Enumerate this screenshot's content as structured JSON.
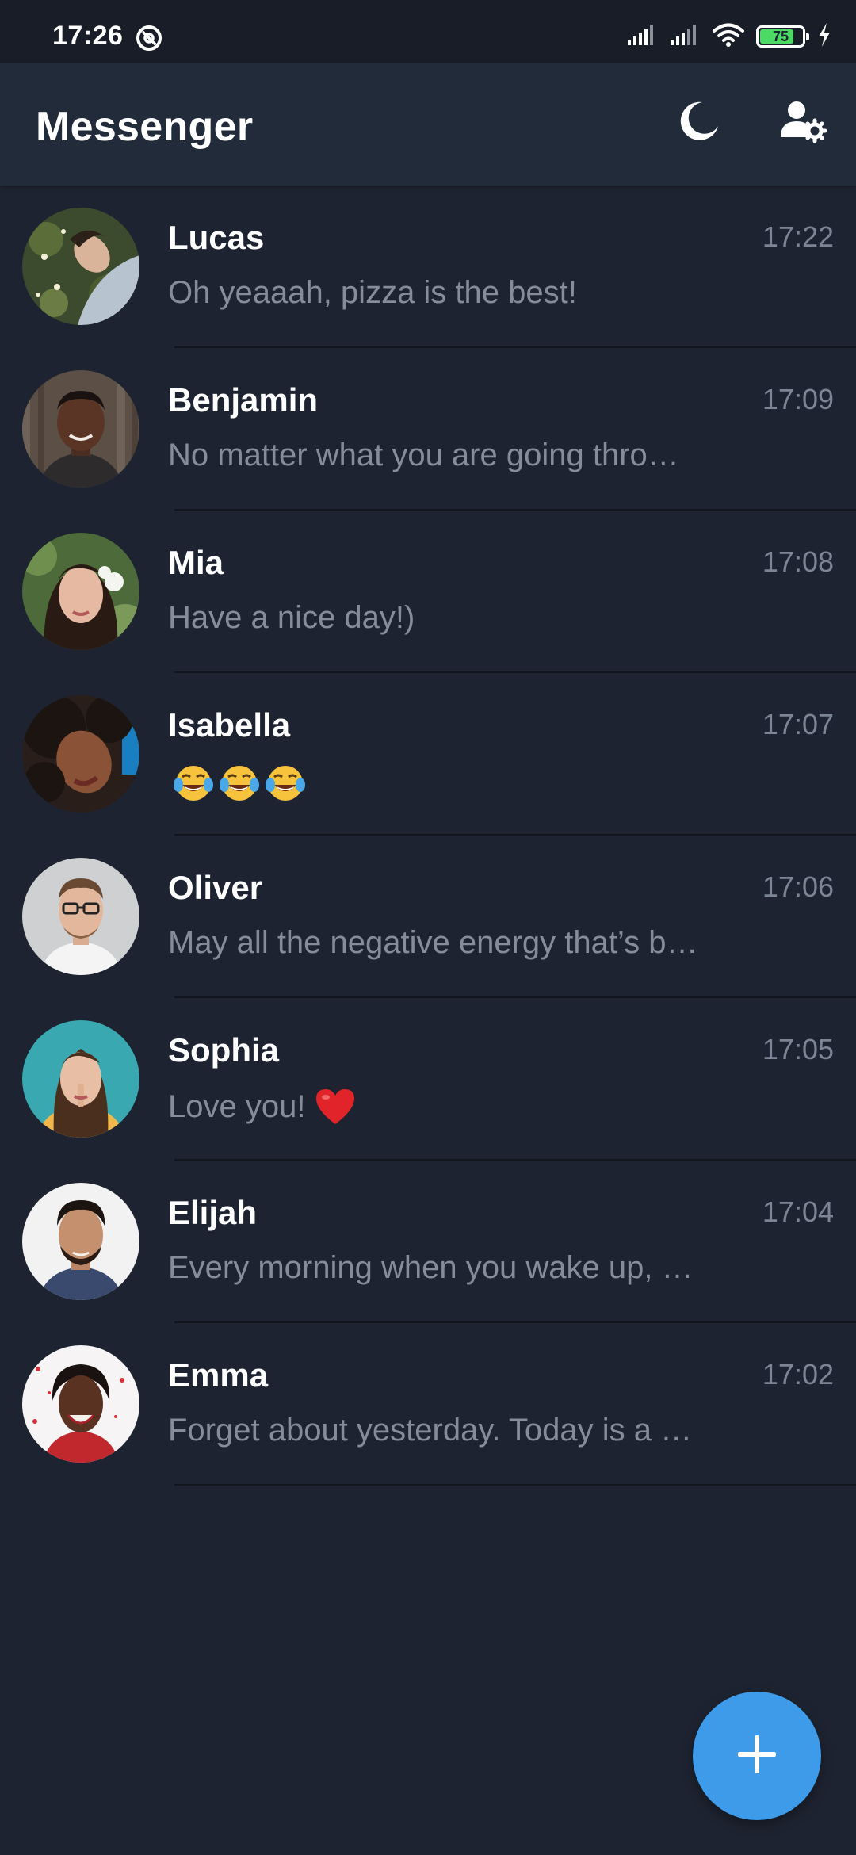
{
  "status_bar": {
    "time": "17:26",
    "battery_level": "75",
    "icons": [
      "do-not-disturb-icon",
      "signal-icon",
      "signal-icon",
      "wifi-icon",
      "battery-icon",
      "charging-icon"
    ]
  },
  "app_bar": {
    "title": "Messenger",
    "actions": [
      "moon-icon",
      "user-settings-icon"
    ]
  },
  "colors": {
    "background": "#1d2330",
    "app_bar": "#222b3a",
    "accent": "#3d9be9",
    "name_text": "#ffffff",
    "secondary_text": "#858d9b"
  },
  "chats": [
    {
      "name": "Lucas",
      "time": "17:22",
      "preview": "Oh yeaaah, pizza is the best!"
    },
    {
      "name": "Benjamin",
      "time": "17:09",
      "preview": "No matter what you are going thro…"
    },
    {
      "name": "Mia",
      "time": "17:08",
      "preview": "Have a nice day!)"
    },
    {
      "name": "Isabella",
      "time": "17:07",
      "preview": "",
      "preview_emoji": [
        "laughing-tears-emoji",
        "laughing-tears-emoji",
        "laughing-tears-emoji"
      ]
    },
    {
      "name": "Oliver",
      "time": "17:06",
      "preview": "May all the negative energy that’s b…"
    },
    {
      "name": "Sophia",
      "time": "17:05",
      "preview": "Love you!",
      "preview_emoji": [
        "red-heart-emoji"
      ]
    },
    {
      "name": "Elijah",
      "time": "17:04",
      "preview": "Every morning when you wake up, …"
    },
    {
      "name": "Emma",
      "time": "17:02",
      "preview": "Forget about yesterday. Today is a …"
    }
  ],
  "fab": {
    "icon": "plus-icon"
  }
}
